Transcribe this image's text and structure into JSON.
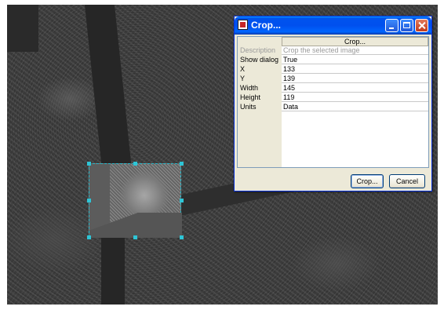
{
  "dialog": {
    "title": "Crop...",
    "header": "Crop...",
    "rows": [
      {
        "key": "Description",
        "value": "Crop the selected image"
      },
      {
        "key": "Show dialog",
        "value": "True"
      },
      {
        "key": "X",
        "value": "133"
      },
      {
        "key": "Y",
        "value": "139"
      },
      {
        "key": "Width",
        "value": "145"
      },
      {
        "key": "Height",
        "value": "119"
      },
      {
        "key": "Units",
        "value": "Data"
      }
    ],
    "crop_button": "Crop...",
    "cancel_button": "Cancel"
  },
  "colors": {
    "selection": "#29b6c8",
    "titlebar": "#0053ee"
  },
  "icons": [
    "app-icon",
    "minimize-icon",
    "maximize-icon",
    "close-icon"
  ]
}
